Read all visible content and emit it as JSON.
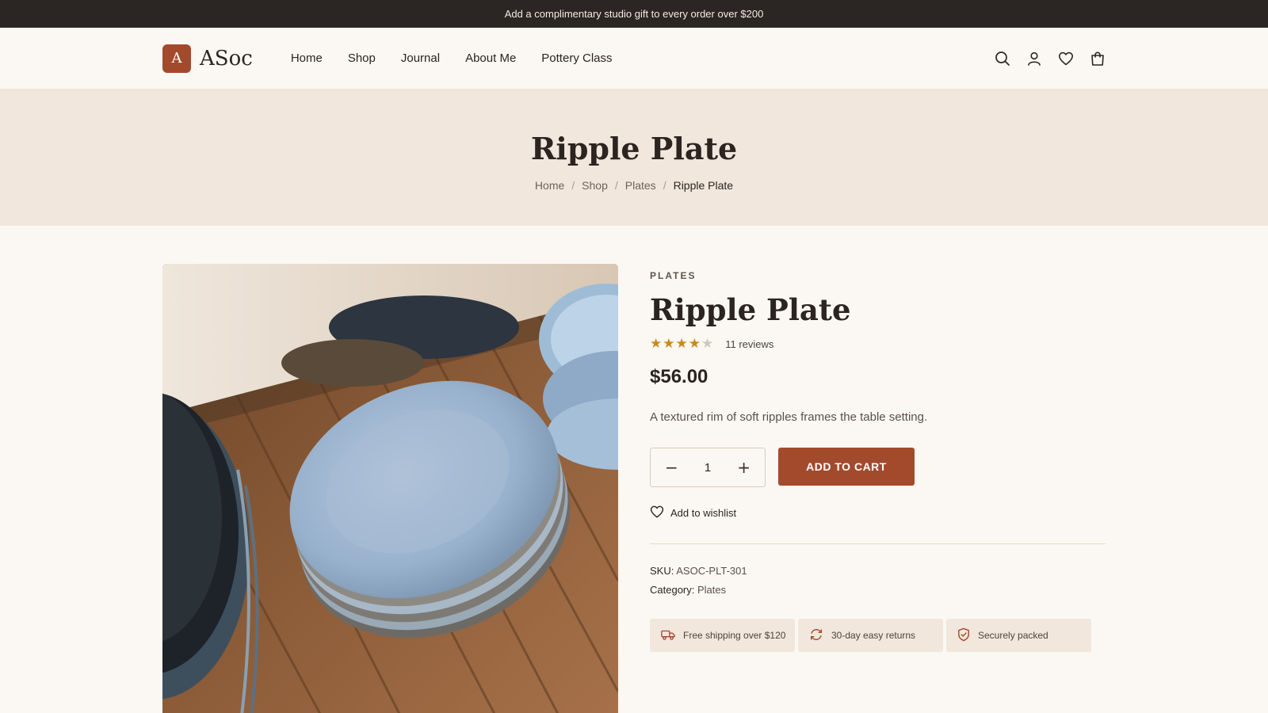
{
  "promo": {
    "text": "Add a complimentary studio gift to every order over $200"
  },
  "brand": {
    "logo_letter": "A",
    "name": "ASoc",
    "accent": "#a44a2c"
  },
  "nav": {
    "items": [
      {
        "label": "Home"
      },
      {
        "label": "Shop"
      },
      {
        "label": "Journal"
      },
      {
        "label": "About Me"
      },
      {
        "label": "Pottery Class"
      }
    ],
    "icons": [
      "search-icon",
      "account-icon",
      "wishlist-icon",
      "cart-icon"
    ]
  },
  "hero": {
    "title": "Ripple Plate",
    "breadcrumb": [
      {
        "label": "Home"
      },
      {
        "label": "Shop"
      },
      {
        "label": "Plates"
      },
      {
        "label": "Ripple Plate"
      }
    ],
    "separator": "/"
  },
  "product": {
    "category_eyebrow": "PLATES",
    "title": "Ripple Plate",
    "rating": 4,
    "rating_max": 5,
    "reviews": "11 reviews",
    "price": "$56.00",
    "description": "A textured rim of soft ripples frames the table setting.",
    "quantity": "1",
    "add_to_cart": "ADD TO CART",
    "wishlist": "Add to wishlist",
    "sku_label": "SKU:",
    "sku": "ASOC-PLT-301",
    "category_label": "Category:",
    "category": "Plates",
    "badges": [
      {
        "icon": "truck-icon",
        "label": "Free shipping over $120"
      },
      {
        "icon": "returns-icon",
        "label": "30-day easy returns"
      },
      {
        "icon": "shield-icon",
        "label": "Securely packed"
      }
    ]
  },
  "colors": {
    "star_filled": "#c88a1b",
    "star_empty": "#cfc6bd"
  }
}
